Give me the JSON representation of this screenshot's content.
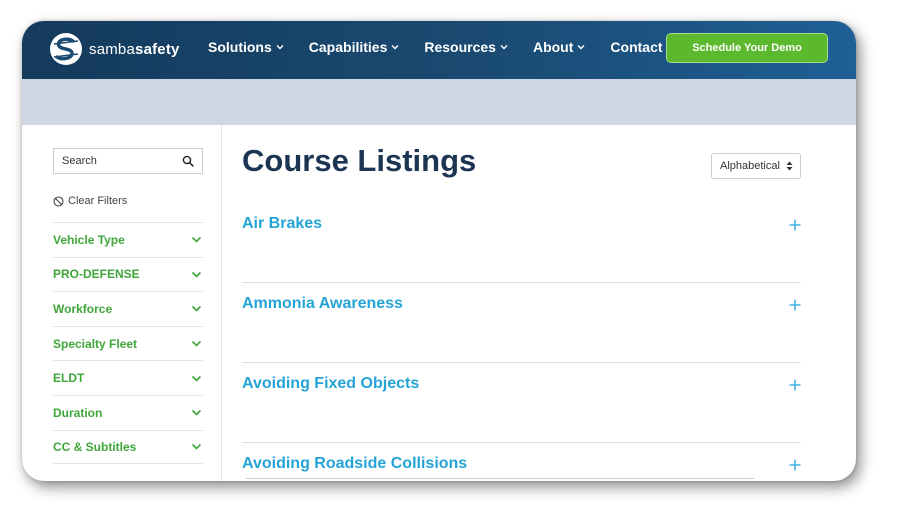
{
  "brand": {
    "name_light": "samba",
    "name_bold": "safety"
  },
  "nav": {
    "items": [
      {
        "label": "Solutions",
        "has_dropdown": true
      },
      {
        "label": "Capabilities",
        "has_dropdown": true
      },
      {
        "label": "Resources",
        "has_dropdown": true
      },
      {
        "label": "About",
        "has_dropdown": true
      },
      {
        "label": "Contact",
        "has_dropdown": false
      }
    ],
    "cta_label": "Schedule Your Demo"
  },
  "sidebar": {
    "search_placeholder": "Search",
    "clear_filters_label": "Clear Filters",
    "filters": [
      {
        "label": "Vehicle Type"
      },
      {
        "label": "PRO-DEFENSE"
      },
      {
        "label": "Workforce"
      },
      {
        "label": "Specialty Fleet"
      },
      {
        "label": "ELDT"
      },
      {
        "label": "Duration"
      },
      {
        "label": "CC & Subtitles"
      }
    ]
  },
  "main": {
    "title": "Course Listings",
    "sort_label": "Alphabetical",
    "courses": [
      {
        "title": "Air Brakes"
      },
      {
        "title": "Ammonia Awareness"
      },
      {
        "title": "Avoiding Fixed Objects"
      },
      {
        "title": "Avoiding Roadside Collisions"
      }
    ]
  },
  "colors": {
    "nav_bg": "#1a4a72",
    "cta_green": "#5cb82c",
    "filter_green": "#3fa63a",
    "course_blue": "#24a4d6",
    "title_navy": "#1c3553",
    "band_gray": "#cdd6e2"
  },
  "icons": {
    "logo": "samba-s-logo-icon",
    "search": "search-icon",
    "clear": "no-entry-icon",
    "filter_toggle": "chevron-down-icon",
    "sort": "sort-arrows-icon",
    "expand": "plus-icon"
  }
}
